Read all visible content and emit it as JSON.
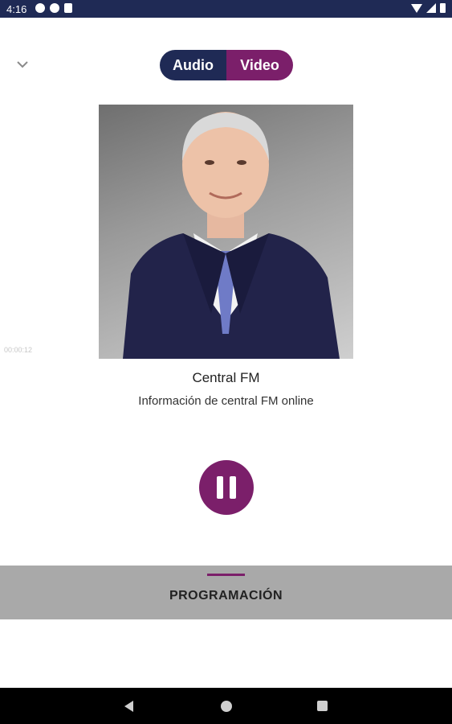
{
  "status_bar": {
    "time": "4:16"
  },
  "player": {
    "toggle": {
      "audio_label": "Audio",
      "video_label": "Video"
    },
    "faint_text": "00:00:12",
    "station_name": "Central FM",
    "station_description": "Información de central FM online"
  },
  "tabs": {
    "programacion_label": "PROGRAMACIÓN"
  },
  "colors": {
    "primary_navy": "#1f2a55",
    "accent_purple": "#7b1f6a",
    "tab_bar_gray": "#a9a9a9"
  },
  "icons": {
    "collapse": "chevron-down-icon",
    "pause": "pause-icon",
    "nav_back": "back-icon",
    "nav_home": "home-icon",
    "nav_recents": "recents-icon"
  }
}
